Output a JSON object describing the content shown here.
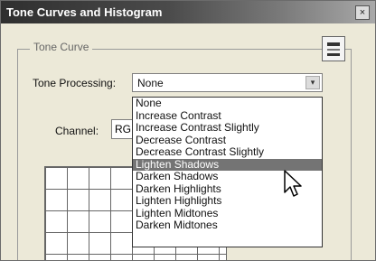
{
  "window": {
    "title": "Tone Curves and Histogram",
    "close_glyph": "×"
  },
  "tone_curve": {
    "legend": "Tone Curve",
    "tone_processing_label": "Tone Processing:",
    "tone_processing_value": "None",
    "dropdown_arrow_glyph": "▾",
    "channel_label": "Channel:",
    "channel_value": "RG",
    "options": [
      "None",
      "Increase Contrast",
      "Increase Contrast Slightly",
      "Decrease Contrast",
      "Decrease Contrast Slightly",
      "Lighten Shadows",
      "Darken Shadows",
      "Darken Highlights",
      "Lighten Highlights",
      "Lighten Midtones",
      "Darken Midtones"
    ],
    "highlighted_option": "Lighten Shadows"
  },
  "colors": {
    "highlight": "#747474",
    "dialog_bg": "#ece9d8"
  }
}
